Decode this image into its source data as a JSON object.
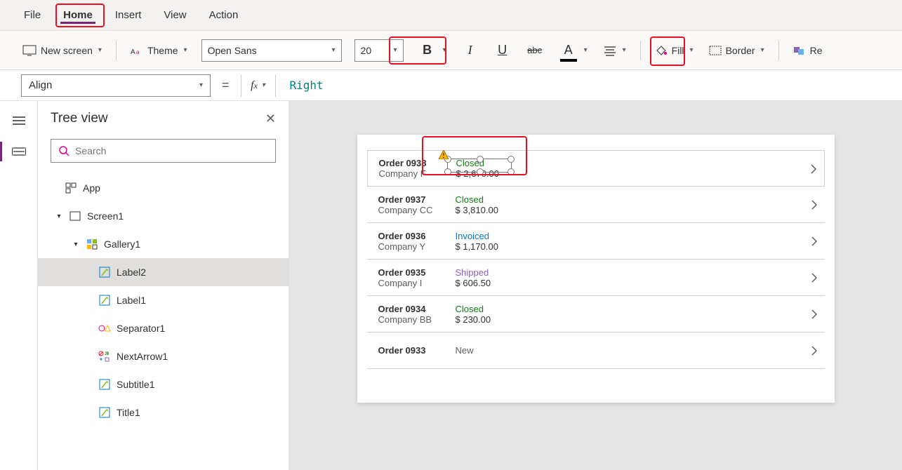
{
  "menu": {
    "file": "File",
    "home": "Home",
    "insert": "Insert",
    "view": "View",
    "action": "Action"
  },
  "ribbon": {
    "new_screen": "New screen",
    "theme": "Theme",
    "font": "Open Sans",
    "size": "20",
    "fill": "Fill",
    "border": "Border",
    "reorder": "Re"
  },
  "formula": {
    "property": "Align",
    "value": "Right"
  },
  "tree": {
    "title": "Tree view",
    "search_placeholder": "Search",
    "app": "App",
    "screen1": "Screen1",
    "gallery1": "Gallery1",
    "label2": "Label2",
    "label1": "Label1",
    "separator1": "Separator1",
    "nextarrow1": "NextArrow1",
    "subtitle1": "Subtitle1",
    "title1": "Title1"
  },
  "orders": [
    {
      "id": "Order 0938",
      "company": "Company F",
      "status": "Closed",
      "price": "$ 2,670.00"
    },
    {
      "id": "Order 0937",
      "company": "Company CC",
      "status": "Closed",
      "price": "$ 3,810.00"
    },
    {
      "id": "Order 0936",
      "company": "Company Y",
      "status": "Invoiced",
      "price": "$ 1,170.00"
    },
    {
      "id": "Order 0935",
      "company": "Company I",
      "status": "Shipped",
      "price": "$ 606.50"
    },
    {
      "id": "Order 0934",
      "company": "Company BB",
      "status": "Closed",
      "price": "$ 230.00"
    },
    {
      "id": "Order 0933",
      "company": "",
      "status": "New",
      "price": ""
    }
  ]
}
